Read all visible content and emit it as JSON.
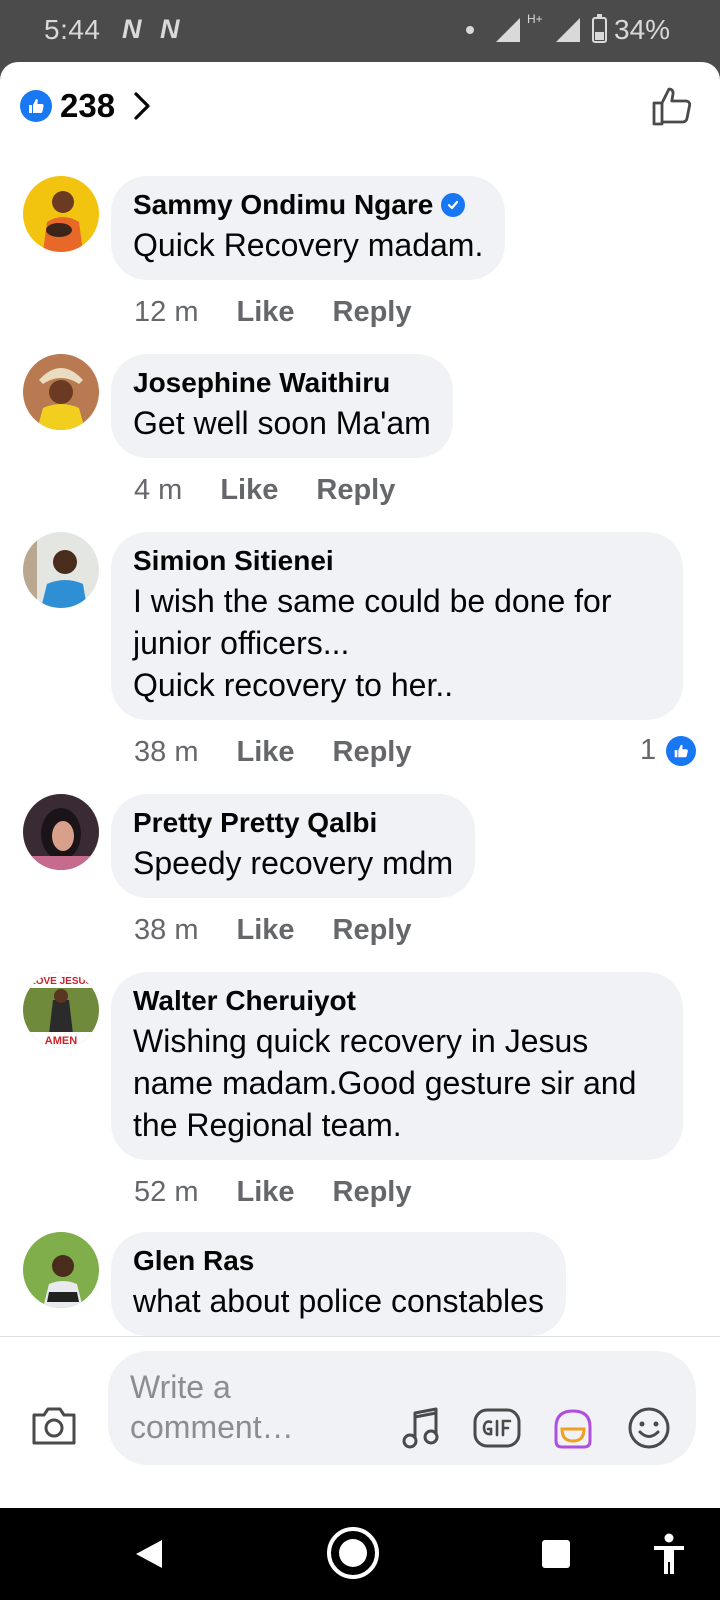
{
  "status_bar": {
    "time": "5:44",
    "network_1": "N",
    "network_2": "N",
    "network_type": "H+",
    "battery": "34%"
  },
  "header": {
    "reaction_count": "238"
  },
  "comments": [
    {
      "author": "Sammy Ondimu Ngare",
      "verified": true,
      "text": "Quick Recovery madam.",
      "time": "12 m",
      "like_label": "Like",
      "reply_label": "Reply"
    },
    {
      "author": "Josephine Waithiru",
      "text": "Get well soon Ma'am",
      "time": "4 m",
      "like_label": "Like",
      "reply_label": "Reply"
    },
    {
      "author": "Simion Sitienei",
      "text": "I wish the same could be done for junior officers...",
      "text2": "Quick recovery to her..",
      "time": "38 m",
      "like_label": "Like",
      "reply_label": "Reply",
      "reactions": "1"
    },
    {
      "author": "Pretty Pretty Qalbi",
      "text": "Speedy recovery mdm",
      "time": "38 m",
      "like_label": "Like",
      "reply_label": "Reply"
    },
    {
      "author": "Walter Cheruiyot",
      "text": "Wishing quick recovery in Jesus name madam.Good gesture sir and the Regional team.",
      "time": "52 m",
      "like_label": "Like",
      "reply_label": "Reply"
    },
    {
      "author": "Glen Ras",
      "text": "what about police constables"
    }
  ],
  "avatar_badge_text": {
    "top": "LOVE JESUS",
    "bottom": "AMEN"
  },
  "composer": {
    "placeholder": "Write a comment…"
  },
  "icons": [
    "like-icon",
    "chevron-right-icon",
    "thumbs-up-outline-icon",
    "verified-icon",
    "camera-icon",
    "music-note-icon",
    "gif-icon",
    "avatar-sticker-icon",
    "emoji-icon",
    "back-icon",
    "home-icon",
    "recents-icon",
    "accessibility-icon"
  ],
  "colors": {
    "accent": "#1877f2",
    "bubble": "#f0f2f5",
    "meta_text": "#65676b"
  }
}
